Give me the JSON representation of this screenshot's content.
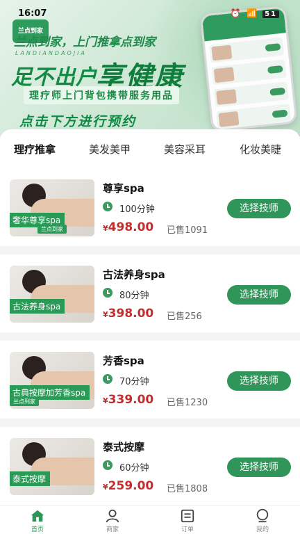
{
  "status": {
    "time": "16:07",
    "battery": "51"
  },
  "banner": {
    "logo": "兰点到家",
    "line1": "兰点到家，上门推拿点到家",
    "pinyin": "LANDIANDAOJIA",
    "big1": "足不出户",
    "big2": "享健康",
    "sub": "理疗师上门背包携带服务用品",
    "tip": "点击下方进行预约"
  },
  "tabs": [
    {
      "label": "理疗推拿",
      "active": true
    },
    {
      "label": "美发美甲",
      "active": false
    },
    {
      "label": "美容采耳",
      "active": false
    },
    {
      "label": "化妆美睫",
      "active": false
    }
  ],
  "services": [
    {
      "title": "尊享spa",
      "duration": "100分钟",
      "price_symbol": "¥",
      "price": "498.00",
      "sold": "已售1091",
      "tag": "奢华尊享spa",
      "brand": "兰点到家",
      "button": "选择技师"
    },
    {
      "title": "古法养身spa",
      "duration": "80分钟",
      "price_symbol": "¥",
      "price": "398.00",
      "sold": "已售256",
      "tag": "古法养身spa",
      "brand": "",
      "button": "选择技师"
    },
    {
      "title": "芳香spa",
      "duration": "70分钟",
      "price_symbol": "¥",
      "price": "339.00",
      "sold": "已售1230",
      "tag": "古典按摩加芳香spa",
      "brand": "兰点到家",
      "button": "选择技师"
    },
    {
      "title": "泰式按摩",
      "duration": "60分钟",
      "price_symbol": "¥",
      "price": "259.00",
      "sold": "已售1808",
      "tag": "泰式按摩",
      "brand": "",
      "button": "选择技师"
    }
  ],
  "bottom_nav": [
    {
      "label": "首页",
      "icon": "home-icon",
      "active": true
    },
    {
      "label": "商家",
      "icon": "merchant-icon",
      "active": false
    },
    {
      "label": "订单",
      "icon": "order-icon",
      "active": false
    },
    {
      "label": "我的",
      "icon": "profile-icon",
      "active": false
    }
  ],
  "colors": {
    "accent": "#2f9559",
    "price": "#c62c2c"
  }
}
